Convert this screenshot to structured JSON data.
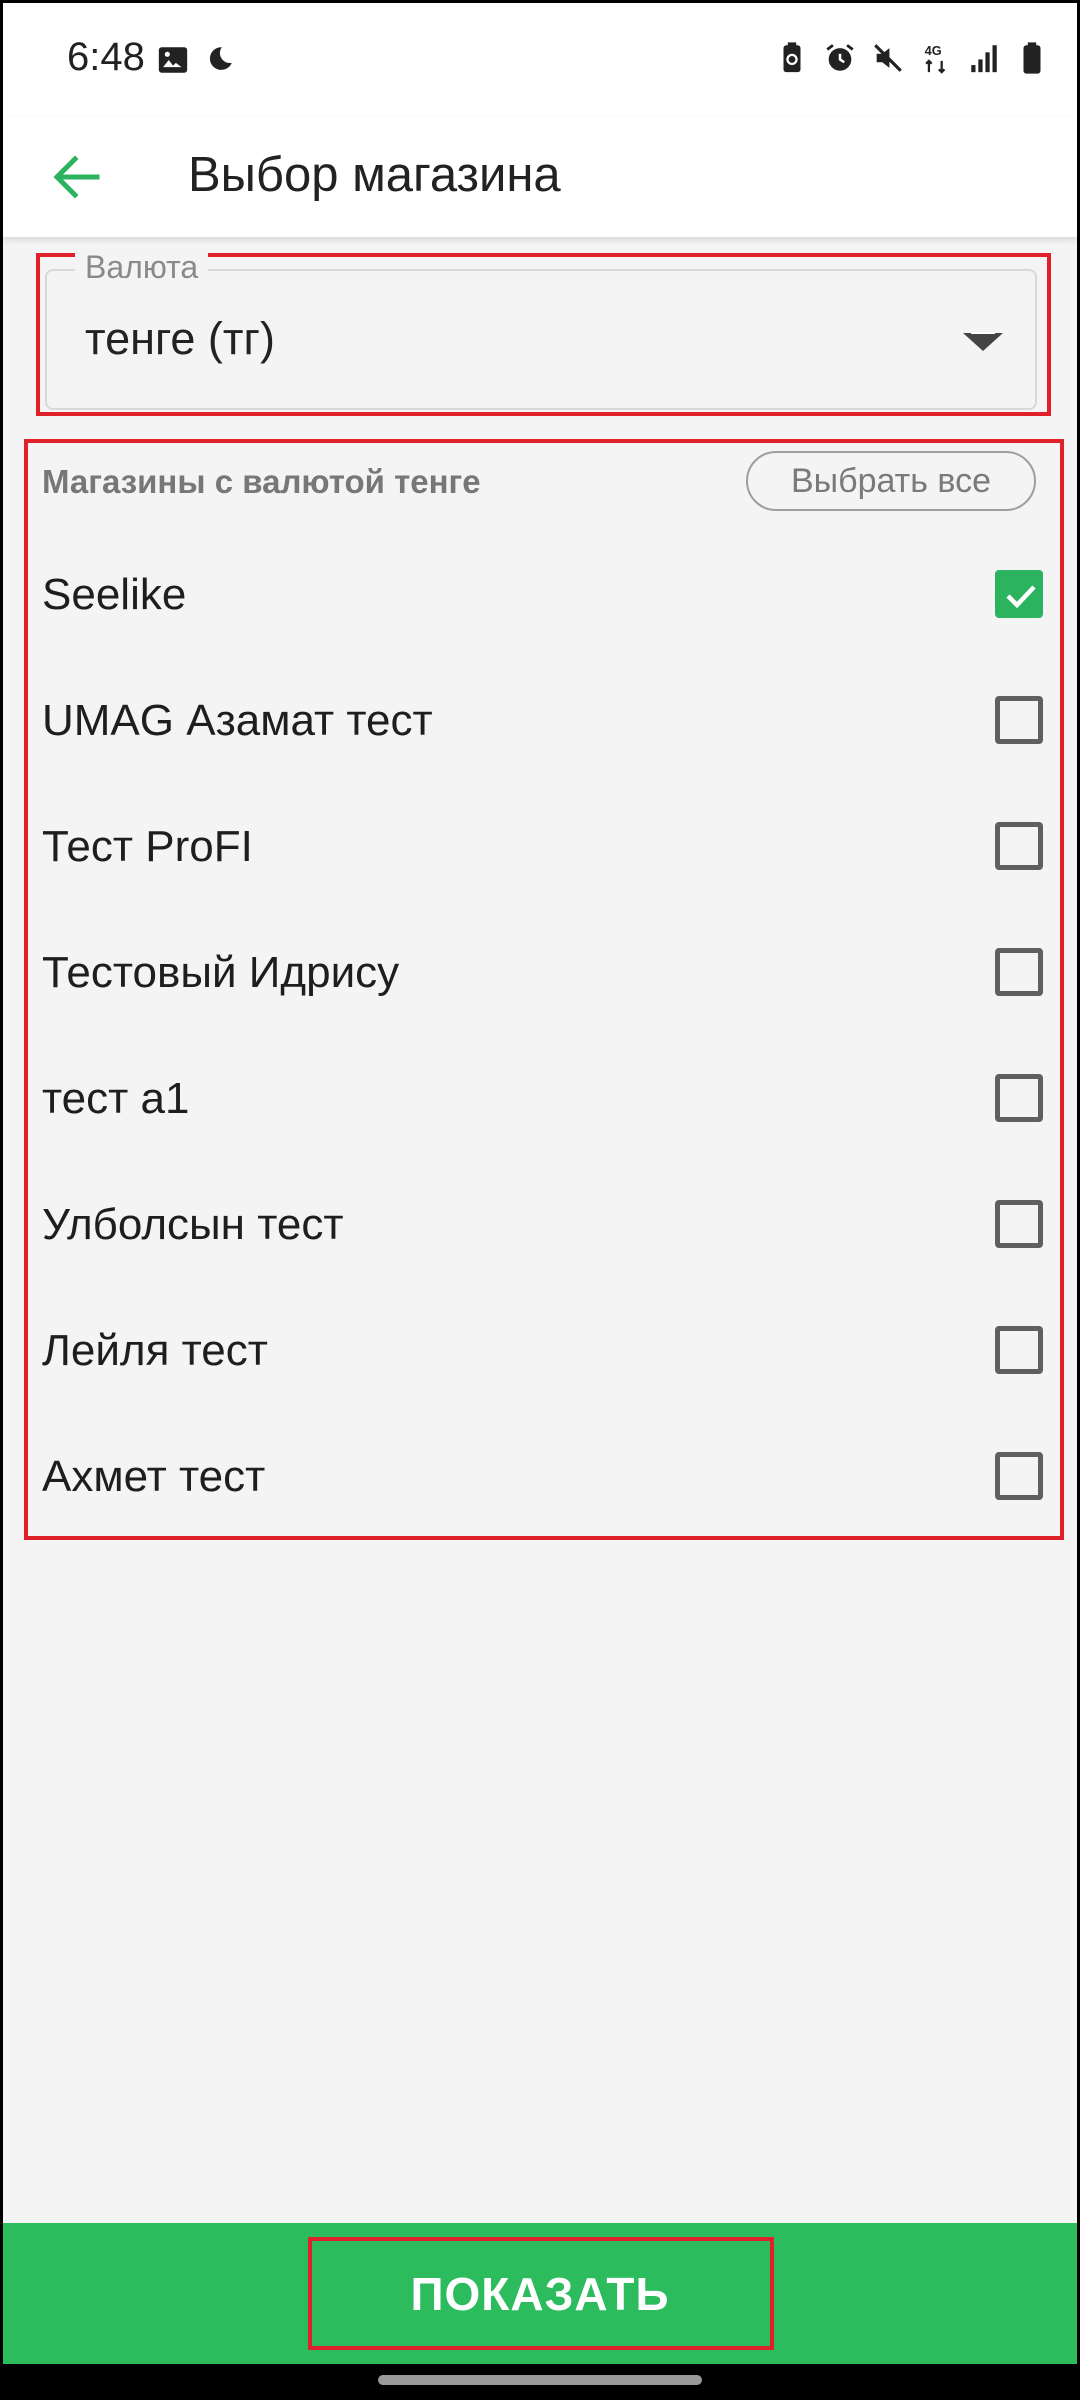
{
  "status_bar": {
    "time": "6:48",
    "left_icons": [
      "image-icon",
      "moon-icon"
    ],
    "right_icons": [
      "battery-saver-icon",
      "alarm-icon",
      "mute-icon",
      "4g-icon",
      "signal-icon",
      "battery-icon"
    ],
    "network_label": "4G"
  },
  "app_bar": {
    "title": "Выбор магазина",
    "back_icon": "arrow-left-icon",
    "accent_color": "#2bb35f"
  },
  "currency": {
    "label": "Валюта",
    "value": "тенге (тг)",
    "icon": "dropdown-arrow-icon"
  },
  "stores": {
    "header": "Магазины с валютой тенге",
    "select_all_label": "Выбрать все",
    "items": [
      {
        "name": "Seelike",
        "checked": true
      },
      {
        "name": "UMAG Азамат тест",
        "checked": false
      },
      {
        "name": "Тест ProFI",
        "checked": false
      },
      {
        "name": "Тестовый Идрису",
        "checked": false
      },
      {
        "name": "тест а1",
        "checked": false
      },
      {
        "name": "Улболсын тест",
        "checked": false
      },
      {
        "name": "Лейля тест",
        "checked": false
      },
      {
        "name": "Ахмет тест",
        "checked": false
      }
    ]
  },
  "footer": {
    "show_label": "ПОКАЗАТЬ",
    "color": "#2cbc5e"
  },
  "highlight_color": "#e0202a"
}
